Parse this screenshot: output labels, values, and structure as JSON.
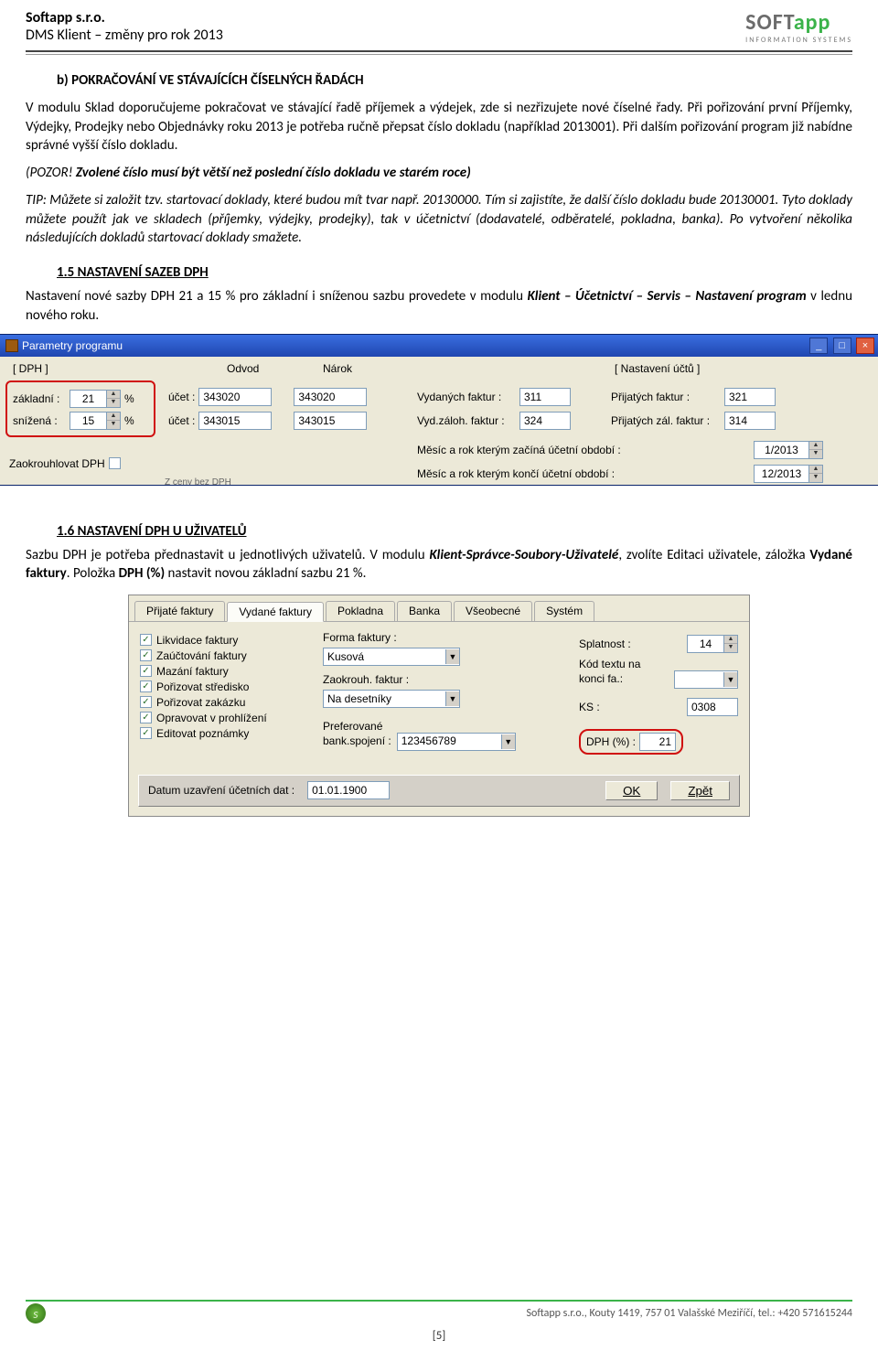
{
  "header": {
    "company": "Softapp  s.r.o.",
    "subtitle": "DMS Klient – změny pro rok 2013",
    "logo_part1": "SOFT",
    "logo_part2": "app",
    "logo_sub": "INFORMATION SYSTEMS"
  },
  "section_b": {
    "title": "b)   POKRAČOVÁNÍ VE STÁVAJÍCÍCH ČÍSELNÝCH ŘADÁCH",
    "p1": "V modulu Sklad doporučujeme pokračovat ve stávající řadě příjemek a výdejek, zde si nezřizujete nové číselné řady. Při pořizování první Příjemky, Výdejky, Prodejky nebo Objednávky roku 2013 je potřeba ručně přepsat číslo dokladu (například 2013001). Při dalším pořizování program již nabídne správné vyšší číslo dokladu.",
    "p2_prefix": "(POZOR!",
    "p2_rest": " Zvolené číslo musí být větší než poslední číslo dokladu ve starém roce)",
    "tip": "TIP:  Můžete si založit tzv. startovací doklady, které budou mít tvar např. 20130000. Tím si zajistíte, že další číslo dokladu bude 20130001. Tyto doklady můžete použít jak ve skladech (příjemky, výdejky, prodejky), tak v účetnictví (dodavatelé, odběratelé, pokladna, banka). Po vytvoření několika následujících dokladů startovací doklady smažete."
  },
  "sec15": {
    "head": "1.5 NASTAVENÍ SAZEB DPH",
    "p_a": "Nastavení nové sazby DPH 21 a 15 % pro základní i sníženou sazbu provedete v modulu ",
    "p_b": "Klient – Účetnictví – Servis – Nastavení program",
    "p_c": " v lednu nového roku."
  },
  "win1": {
    "title": "Parametry programu",
    "grp_dph": "[ DPH ]",
    "odvod": "Odvod",
    "narok": "Nárok",
    "grp_nast": "[ Nastavení účtů ]",
    "zakladni_lbl": "základní :",
    "zakladni_val": "21",
    "snizena_lbl": "snížená :",
    "snizena_val": "15",
    "pct": "%",
    "ucet_lbl": "účet :",
    "u1_odvod": "343020",
    "u1_narok": "343020",
    "u2_odvod": "343015",
    "u2_narok": "343015",
    "vyd_f_lbl": "Vydaných faktur :",
    "vyd_f_val": "311",
    "pri_f_lbl": "Přijatých faktur :",
    "pri_f_val": "321",
    "vyd_z_lbl": "Vyd.záloh. faktur :",
    "vyd_z_val": "324",
    "pri_z_lbl": "Přijatých zál. faktur :",
    "pri_z_val": "314",
    "zaokr_lbl": "Zaokrouhlovat DPH",
    "mes_zac_lbl": "Měsíc a rok kterým začíná účetní období :",
    "mes_zac_val": "1/2013",
    "mes_kon_lbl": "Měsíc a rok kterým končí účetní období :",
    "mes_kon_val": "12/2013",
    "zpus_lbl": "Z ceny bez DPH"
  },
  "sec16": {
    "head": "1.6 NASTAVENÍ DPH U UŽIVATELŮ",
    "p_a": "Sazbu DPH je potřeba přednastavit u jednotlivých uživatelů.  V modulu ",
    "p_b": "Klient-Správce-Soubory-Uživatelé",
    "p_c": ", zvolíte Editaci uživatele, záložka ",
    "p_d": "Vydané faktury",
    "p_e": ". Položka ",
    "p_f": "DPH (%)",
    "p_g": " nastavit novou základní sazbu 21 %."
  },
  "win2": {
    "tabs": [
      "Přijaté faktury",
      "Vydané faktury",
      "Pokladna",
      "Banka",
      "Všeobecné",
      "Systém"
    ],
    "active_tab": 1,
    "checks": [
      "Likvidace faktury",
      "Zaúčtování faktury",
      "Mazání faktury",
      "Pořizovat středisko",
      "Pořizovat zakázku",
      "Opravovat v prohlížení",
      "Editovat poznámky"
    ],
    "forma_lbl": "Forma faktury :",
    "forma_val": "Kusová",
    "zaokr_lbl": "Zaokrouh. faktur :",
    "zaokr_val": "Na desetníky",
    "pref_lbl1": "Preferované",
    "pref_lbl2": "bank.spojení :",
    "pref_val": "123456789",
    "splat_lbl": "Splatnost :",
    "splat_val": "14",
    "kod_lbl1": "Kód textu na",
    "kod_lbl2": "konci fa.:",
    "kod_val": "",
    "ks_lbl": "KS :",
    "ks_val": "0308",
    "dph_lbl": "DPH (%) :",
    "dph_val": "21",
    "datum_lbl": "Datum uzavření účetních dat :",
    "datum_val": "01.01.1900",
    "ok": "OK",
    "zpet": "Zpět"
  },
  "footer": {
    "text": "Softapp s.r.o., Kouty 1419, 757 01 Valašské Meziříčí, tel.: +420 571615244",
    "page": "[5]"
  }
}
